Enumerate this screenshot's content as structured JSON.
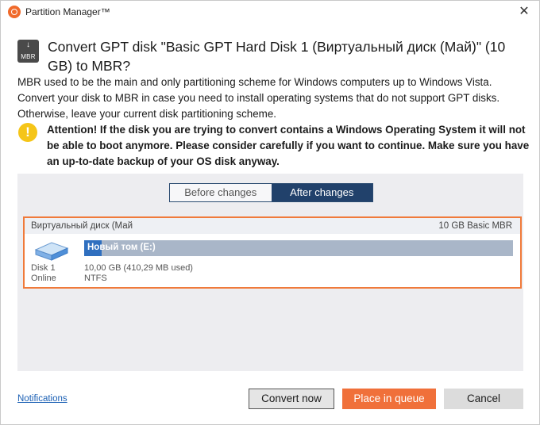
{
  "window": {
    "title": "Partition Manager™",
    "close_glyph": "✕"
  },
  "header": {
    "icon_label": "MBR",
    "icon_arrow": "↓",
    "title": "Convert GPT disk \"Basic GPT Hard Disk 1 (Виртуальный диск (Май)\" (10 GB) to MBR?"
  },
  "description": "MBR used to be the main and only partitioning scheme for Windows computers up to Windows Vista. Convert your disk to MBR in case you need to install operating systems that do not support GPT disks. Otherwise, leave your current disk partitioning scheme.",
  "warning": {
    "icon_glyph": "!",
    "text": "Attention! If the disk you are trying to convert contains a Windows Operating System it will not be able to boot anymore. Please consider carefully if you want to continue. Make sure you have an up-to-date backup of your OS disk anyway."
  },
  "preview": {
    "tabs": {
      "before": "Before changes",
      "after": "After changes",
      "active": "after"
    },
    "disk": {
      "name": "Виртуальный диск (Май",
      "summary": "10 GB Basic MBR",
      "label": "Disk 1",
      "status": "Online",
      "partition": {
        "name": "Новый том (E:)",
        "info": "10,00 GB (410,29 MB used)",
        "filesystem": "NTFS",
        "used_fraction": 0.04
      }
    }
  },
  "footer": {
    "notifications_link": "Notifications",
    "convert_now": "Convert now",
    "place_in_queue": "Place in queue",
    "cancel": "Cancel"
  },
  "colors": {
    "accent": "#f0703a",
    "active_tab": "#21416b",
    "partition_used": "#2f6fbf",
    "partition_free": "#a9b6c8",
    "warning": "#f5c518"
  }
}
